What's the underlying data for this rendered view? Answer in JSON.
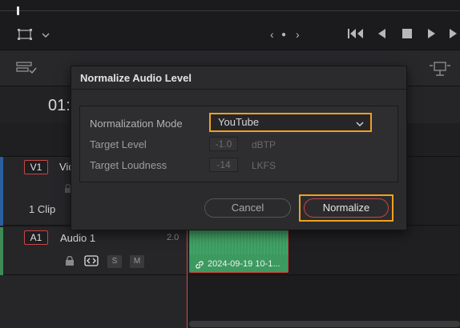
{
  "viewer": {
    "prev_clip_glyph": "‹",
    "dot_glyph": "●",
    "next_clip_glyph": "›"
  },
  "timeline": {
    "timecode": "01:",
    "v1": {
      "tag": "V1",
      "name": "Vid",
      "clip_count": "1 Clip"
    },
    "a1": {
      "tag": "A1",
      "name": "Audio 1",
      "level": "2.0",
      "solo": "S",
      "mute": "M"
    },
    "clip": {
      "label": "2024-09-19 10-1..."
    }
  },
  "dialog": {
    "title": "Normalize Audio Level",
    "mode_label": "Normalization Mode",
    "mode_value": "YouTube",
    "target_level_label": "Target Level",
    "target_level_value": "-1.0",
    "target_level_unit": "dBTP",
    "target_loudness_label": "Target Loudness",
    "target_loudness_value": "-14",
    "target_loudness_unit": "LKFS",
    "cancel_label": "Cancel",
    "normalize_label": "Normalize"
  },
  "colors": {
    "highlight": "#f0a020",
    "video_track": "#2b5f9e",
    "audio_track": "#3f8a55",
    "clip": "#3c9a5f",
    "playhead": "#d84a3e"
  }
}
